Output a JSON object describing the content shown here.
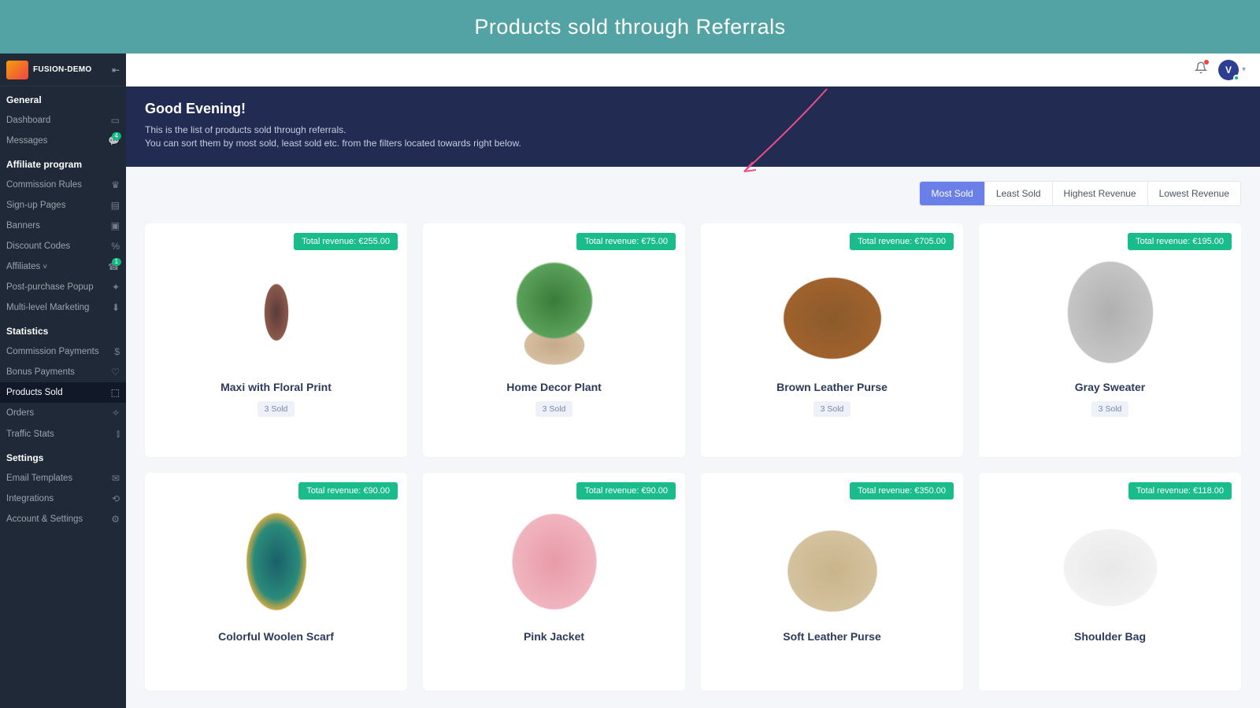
{
  "banner": {
    "title": "Products sold through Referrals"
  },
  "brand": {
    "name": "FUSION-DEMO"
  },
  "topbar": {
    "avatar_initial": "V"
  },
  "hero": {
    "greeting": "Good Evening!",
    "line1": "This is the list of products sold through referrals.",
    "line2": "You can sort them by most sold, least sold etc. from the filters located towards right below."
  },
  "sidebar": {
    "sections": [
      {
        "title": "General",
        "items": [
          {
            "label": "Dashboard",
            "icon": "▭"
          },
          {
            "label": "Messages",
            "icon": "💬",
            "badge": "4"
          }
        ]
      },
      {
        "title": "Affiliate program",
        "items": [
          {
            "label": "Commission Rules",
            "icon": "♛"
          },
          {
            "label": "Sign-up Pages",
            "icon": "▤"
          },
          {
            "label": "Banners",
            "icon": "▣"
          },
          {
            "label": "Discount Codes",
            "icon": "%"
          },
          {
            "label": "Affiliates",
            "icon": "☎",
            "chevron": true,
            "badge": "1"
          },
          {
            "label": "Post-purchase Popup",
            "icon": "✦"
          },
          {
            "label": "Multi-level Marketing",
            "icon": "⬇"
          }
        ]
      },
      {
        "title": "Statistics",
        "items": [
          {
            "label": "Commission Payments",
            "icon": "$"
          },
          {
            "label": "Bonus Payments",
            "icon": "♡"
          },
          {
            "label": "Products Sold",
            "icon": "⬚",
            "active": true
          },
          {
            "label": "Orders",
            "icon": "✧"
          },
          {
            "label": "Traffic Stats",
            "icon": "⫾"
          }
        ]
      },
      {
        "title": "Settings",
        "items": [
          {
            "label": "Email Templates",
            "icon": "✉"
          },
          {
            "label": "Integrations",
            "icon": "⟲"
          },
          {
            "label": "Account & Settings",
            "icon": "⚙"
          }
        ]
      }
    ]
  },
  "filters": [
    {
      "label": "Most Sold",
      "active": true
    },
    {
      "label": "Least Sold"
    },
    {
      "label": "Highest Revenue"
    },
    {
      "label": "Lowest Revenue"
    }
  ],
  "products": [
    {
      "name": "Maxi with Floral Print",
      "revenue": "Total revenue: €255.00",
      "sold": "3 Sold",
      "shape": "dress"
    },
    {
      "name": "Home Decor Plant",
      "revenue": "Total revenue: €75.00",
      "sold": "3 Sold",
      "shape": "plant"
    },
    {
      "name": "Brown Leather Purse",
      "revenue": "Total revenue: €705.00",
      "sold": "3 Sold",
      "shape": "purse-brown"
    },
    {
      "name": "Gray Sweater",
      "revenue": "Total revenue: €195.00",
      "sold": "3 Sold",
      "shape": "sweater"
    },
    {
      "name": "Colorful Woolen Scarf",
      "revenue": "Total revenue: €90.00",
      "sold": "",
      "shape": "scarf"
    },
    {
      "name": "Pink Jacket",
      "revenue": "Total revenue: €90.00",
      "sold": "",
      "shape": "jacket"
    },
    {
      "name": "Soft Leather Purse",
      "revenue": "Total revenue: €350.00",
      "sold": "",
      "shape": "purse-tan"
    },
    {
      "name": "Shoulder Bag",
      "revenue": "Total revenue: €118.00",
      "sold": "",
      "shape": "bag-white"
    }
  ]
}
